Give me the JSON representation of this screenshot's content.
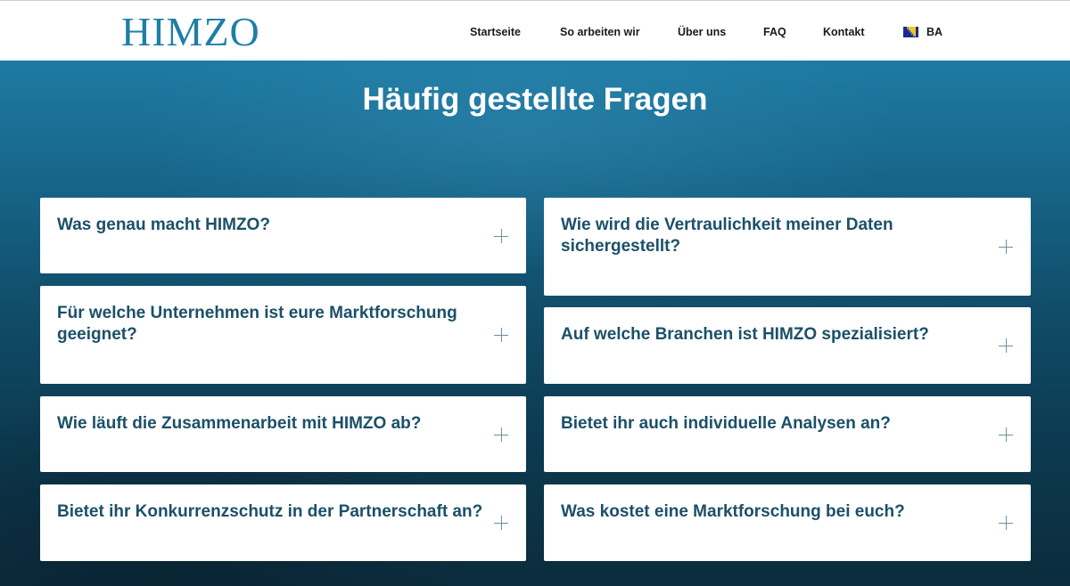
{
  "header": {
    "logo": "HIMZO",
    "nav": {
      "startseite": "Startseite",
      "so_arbeiten_wir": "So arbeiten wir",
      "ueber_uns": "Über uns",
      "faq": "FAQ",
      "kontakt": "Kontakt",
      "language": "BA",
      "language_icon": "bosnia-flag-icon"
    }
  },
  "main": {
    "title": "Häufig gestellte Fragen",
    "faq": [
      {
        "question": "Was genau macht HIMZO?",
        "icon": "plus-icon"
      },
      {
        "question": "Für welche Unternehmen ist eure Marktforschung geeignet?",
        "icon": "plus-icon"
      },
      {
        "question": "Wie läuft die Zusammenarbeit mit HIMZO ab?",
        "icon": "plus-icon"
      },
      {
        "question": "Bietet ihr Konkurrenzschutz in der Partnerschaft an?",
        "icon": "plus-icon"
      },
      {
        "question": "Wie wird die Vertraulichkeit meiner Daten sichergestellt?",
        "icon": "plus-icon"
      },
      {
        "question": "Auf welche Branchen ist HIMZO spezialisiert?",
        "icon": "plus-icon"
      },
      {
        "question": "Bietet ihr auch individuelle Analysen an?",
        "icon": "plus-icon"
      },
      {
        "question": "Was kostet eine Marktforschung bei euch?",
        "icon": "plus-icon"
      }
    ]
  },
  "colors": {
    "brand": "#1f7ea6",
    "question_text": "#1b5068",
    "hero_top": "#1e7aa2",
    "hero_bottom": "#0b2c3c"
  }
}
